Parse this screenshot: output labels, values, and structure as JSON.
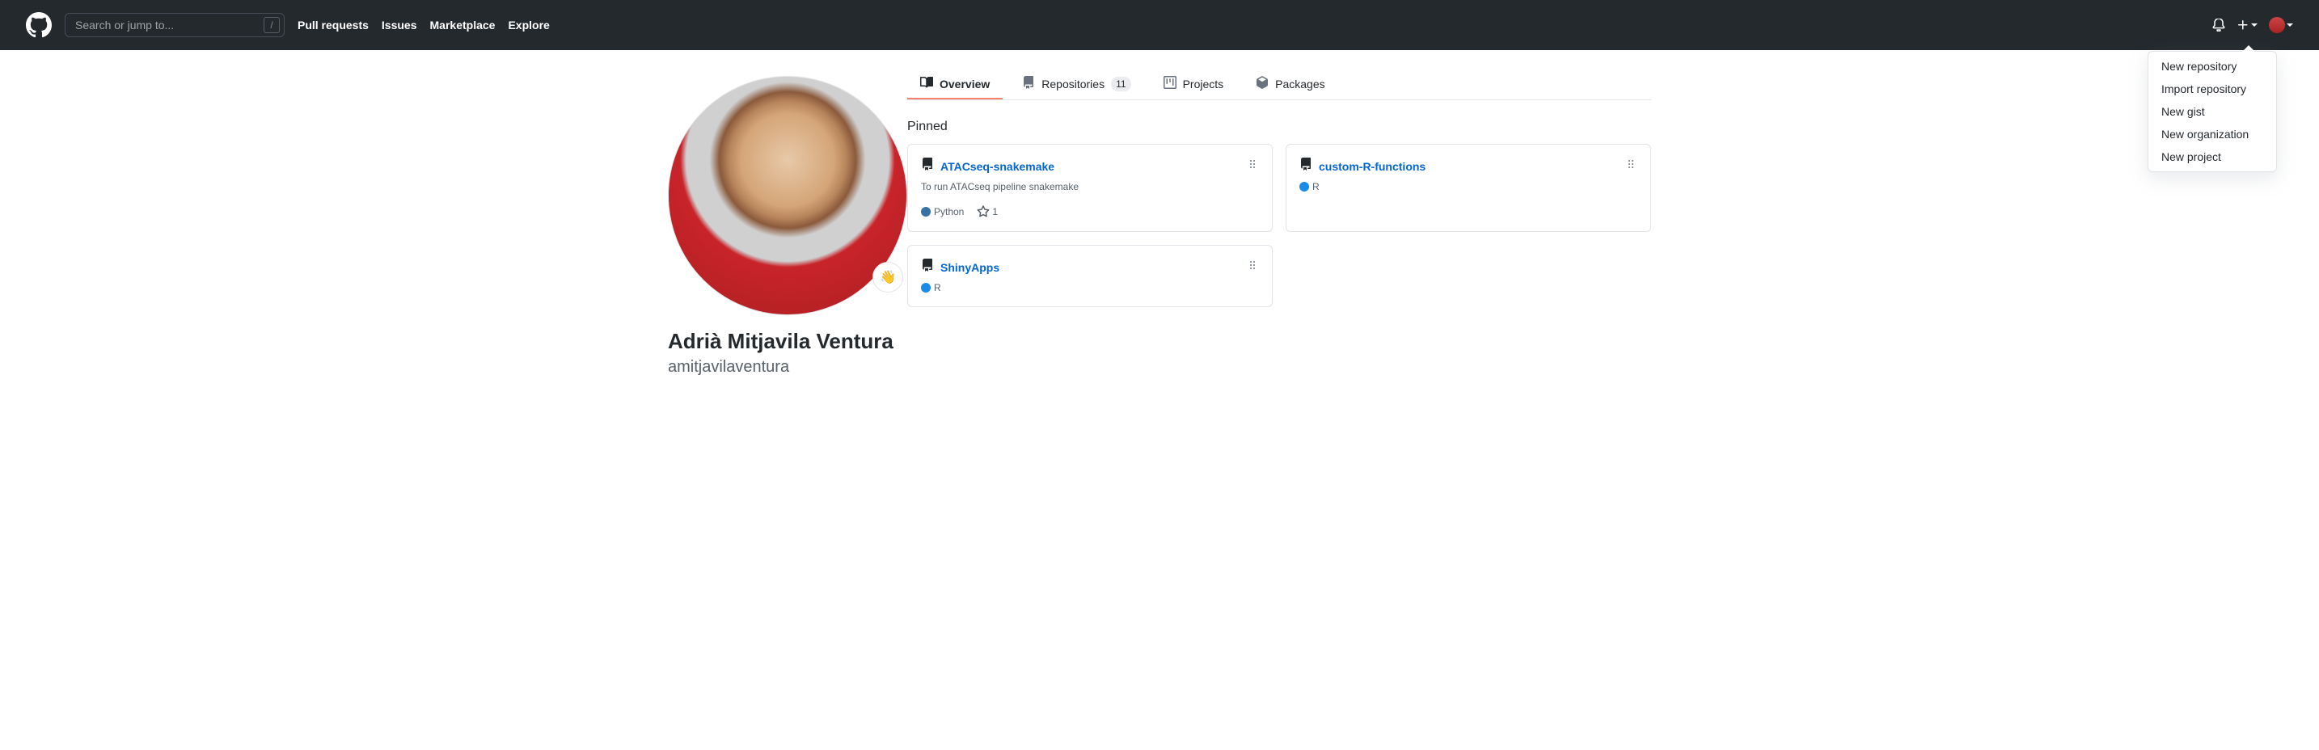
{
  "search": {
    "placeholder": "Search or jump to..."
  },
  "nav": {
    "pull_requests": "Pull requests",
    "issues": "Issues",
    "marketplace": "Marketplace",
    "explore": "Explore"
  },
  "plus_menu": {
    "new_repo": "New repository",
    "import_repo": "Import repository",
    "new_gist": "New gist",
    "new_org": "New organization",
    "new_project": "New project"
  },
  "profile": {
    "name": "Adrià Mitjavila Ventura",
    "username": "amitjavilaventura",
    "status_emoji": "👋"
  },
  "tabs": {
    "overview": "Overview",
    "repositories": "Repositories",
    "repositories_count": "11",
    "projects": "Projects",
    "packages": "Packages"
  },
  "pinned": {
    "title": "Pinned",
    "repos": [
      {
        "name": "ATACseq-snakemake",
        "desc": "To run ATACseq pipeline snakemake",
        "lang": "Python",
        "lang_color": "#3572A5",
        "stars": "1"
      },
      {
        "name": "custom-R-functions",
        "desc": "",
        "lang": "R",
        "lang_color": "#198CE7",
        "stars": ""
      },
      {
        "name": "ShinyApps",
        "desc": "",
        "lang": "R",
        "lang_color": "#198CE7",
        "stars": ""
      }
    ]
  }
}
